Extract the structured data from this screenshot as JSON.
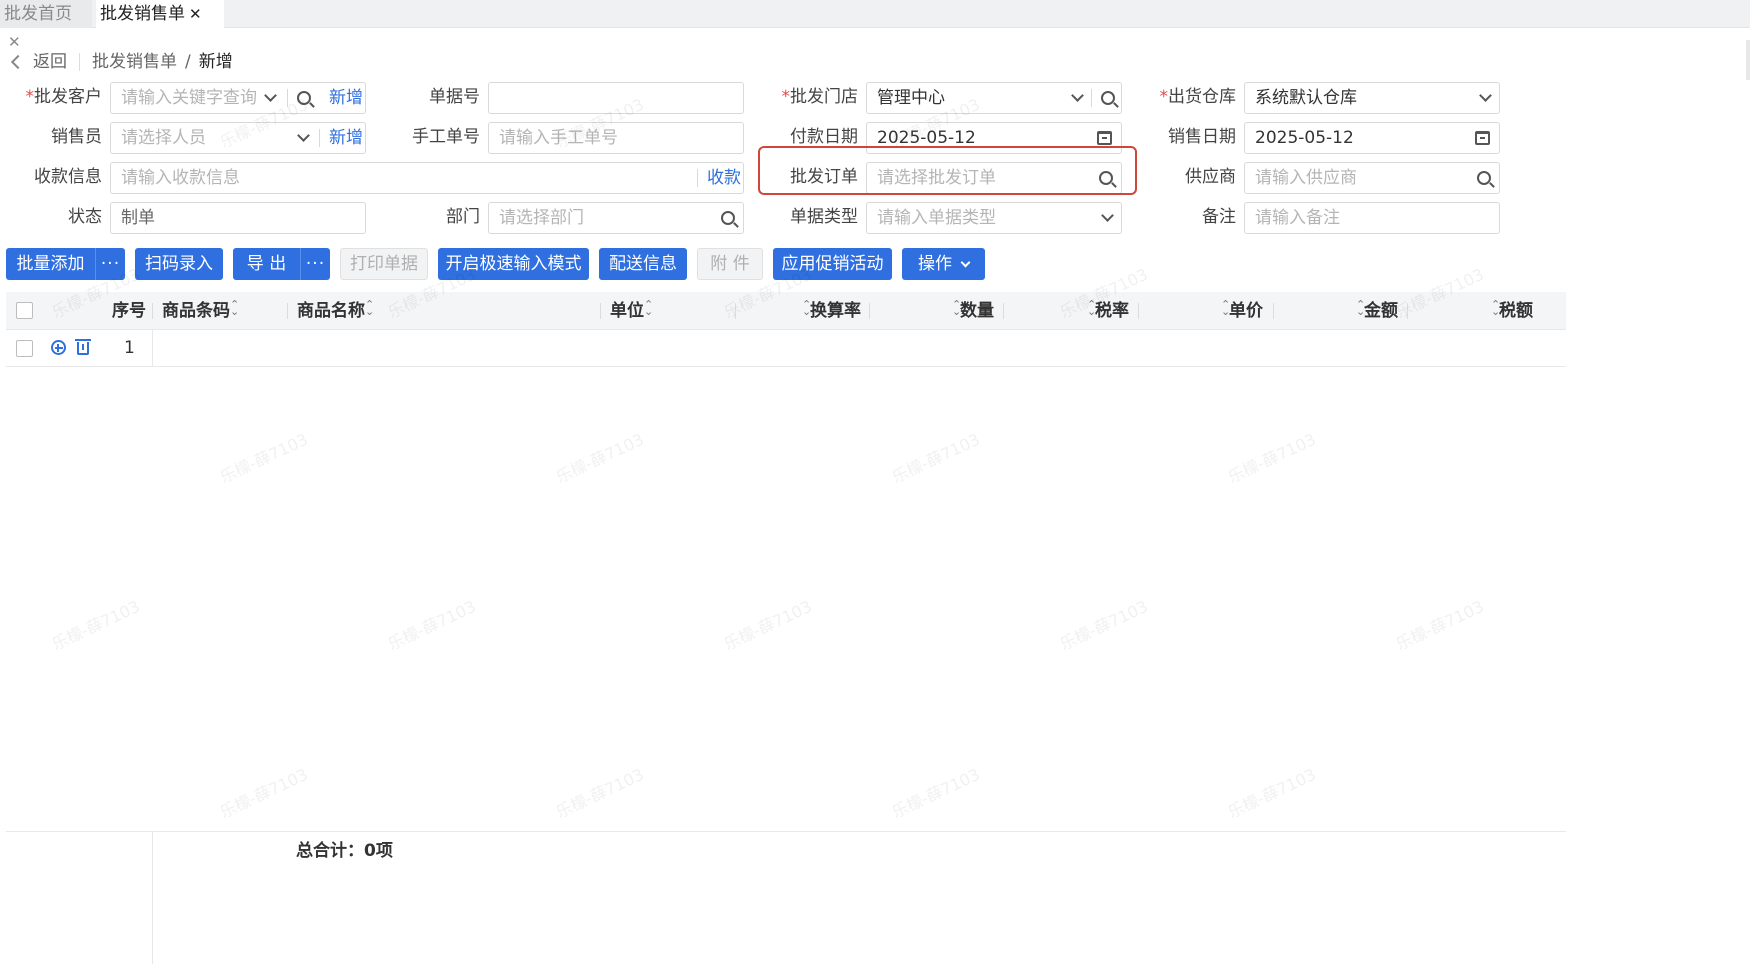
{
  "tabs": [
    {
      "label": "批发首页"
    },
    {
      "label": "批发销售单"
    }
  ],
  "breadcrumb": {
    "back": "返回",
    "parent": "批发销售单",
    "separator": "/",
    "current": "新增"
  },
  "form": {
    "customer": {
      "label": "批发客户",
      "placeholder": "请输入关键字查询",
      "action": "新增"
    },
    "doc_no": {
      "label": "单据号",
      "value": ""
    },
    "store": {
      "label": "批发门店",
      "value": "管理中心"
    },
    "warehouse": {
      "label": "出货仓库",
      "value": "系统默认仓库"
    },
    "salesperson": {
      "label": "销售员",
      "placeholder": "请选择人员",
      "action": "新增"
    },
    "manual_no": {
      "label": "手工单号",
      "placeholder": "请输入手工单号"
    },
    "pay_date": {
      "label": "付款日期",
      "value": "2025-05-12"
    },
    "sale_date": {
      "label": "销售日期",
      "value": "2025-05-12"
    },
    "receipt": {
      "label": "收款信息",
      "placeholder": "请输入收款信息",
      "action": "收款"
    },
    "order": {
      "label": "批发订单",
      "placeholder": "请选择批发订单"
    },
    "supplier": {
      "label": "供应商",
      "placeholder": "请输入供应商"
    },
    "status": {
      "label": "状态",
      "value": "制单"
    },
    "dept": {
      "label": "部门",
      "placeholder": "请选择部门"
    },
    "doc_type": {
      "label": "单据类型",
      "placeholder": "请输入单据类型"
    },
    "remark": {
      "label": "备注",
      "placeholder": "请输入备注"
    },
    "required_mark": "*"
  },
  "toolbar": {
    "batch_add": "批量添加",
    "more": "···",
    "scan": "扫码录入",
    "export": "导 出",
    "print": "打印单据",
    "fast_mode": "开启极速输入模式",
    "delivery": "配送信息",
    "attach": "附 件",
    "promo": "应用促销活动",
    "ops": "操作"
  },
  "table": {
    "columns": [
      "序号",
      "商品条码",
      "商品名称",
      "单位",
      "换算率",
      "数量",
      "税率",
      "单价",
      "金额",
      "税额"
    ],
    "rows": [
      {
        "index": "1"
      }
    ]
  },
  "footer": {
    "total": "总合计：0项"
  },
  "watermark": "乐檬-薛7103",
  "colors": {
    "primary": "#2f6fe0",
    "required": "#e64c4c",
    "highlight": "#d0473a"
  }
}
